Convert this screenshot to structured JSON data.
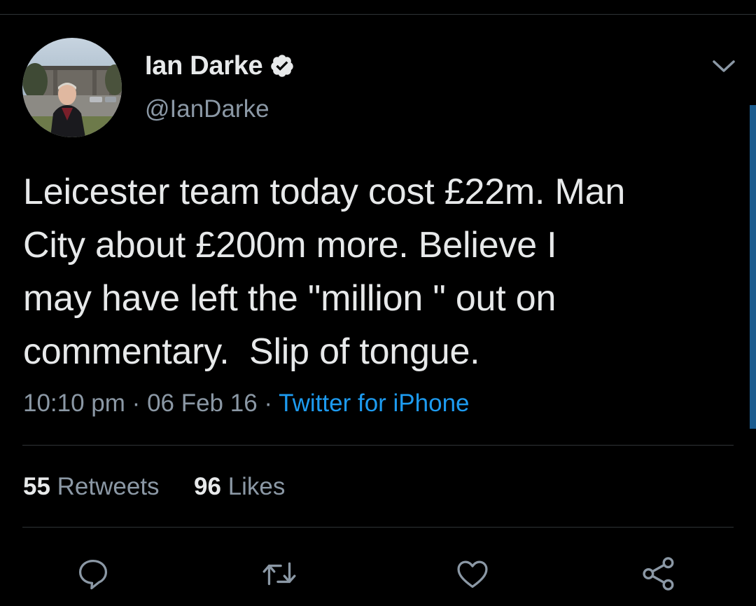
{
  "author": {
    "display_name": "Ian Darke",
    "handle": "@IanDarke",
    "verified": true
  },
  "tweet": {
    "text": "Leicester team today cost £22m. Man\nCity about £200m more. Believe I\nmay have left the \"million \" out on\ncommentary.  Slip of tongue.",
    "time": "10:10 pm",
    "separator": "·",
    "date": "06 Feb 16",
    "source": "Twitter for iPhone"
  },
  "stats": {
    "retweets_count": "55",
    "retweets_label": "Retweets",
    "likes_count": "96",
    "likes_label": "Likes"
  },
  "icons": {
    "verified": "verified-badge-icon",
    "more": "chevron-down-icon",
    "reply": "reply-icon",
    "retweet": "retweet-icon",
    "like": "heart-icon",
    "share": "share-icon"
  },
  "colors": {
    "background": "#000000",
    "text": "#e7e9ea",
    "secondary_text": "#8b98a5",
    "link": "#1d9bf0",
    "divider": "#2f3336"
  }
}
